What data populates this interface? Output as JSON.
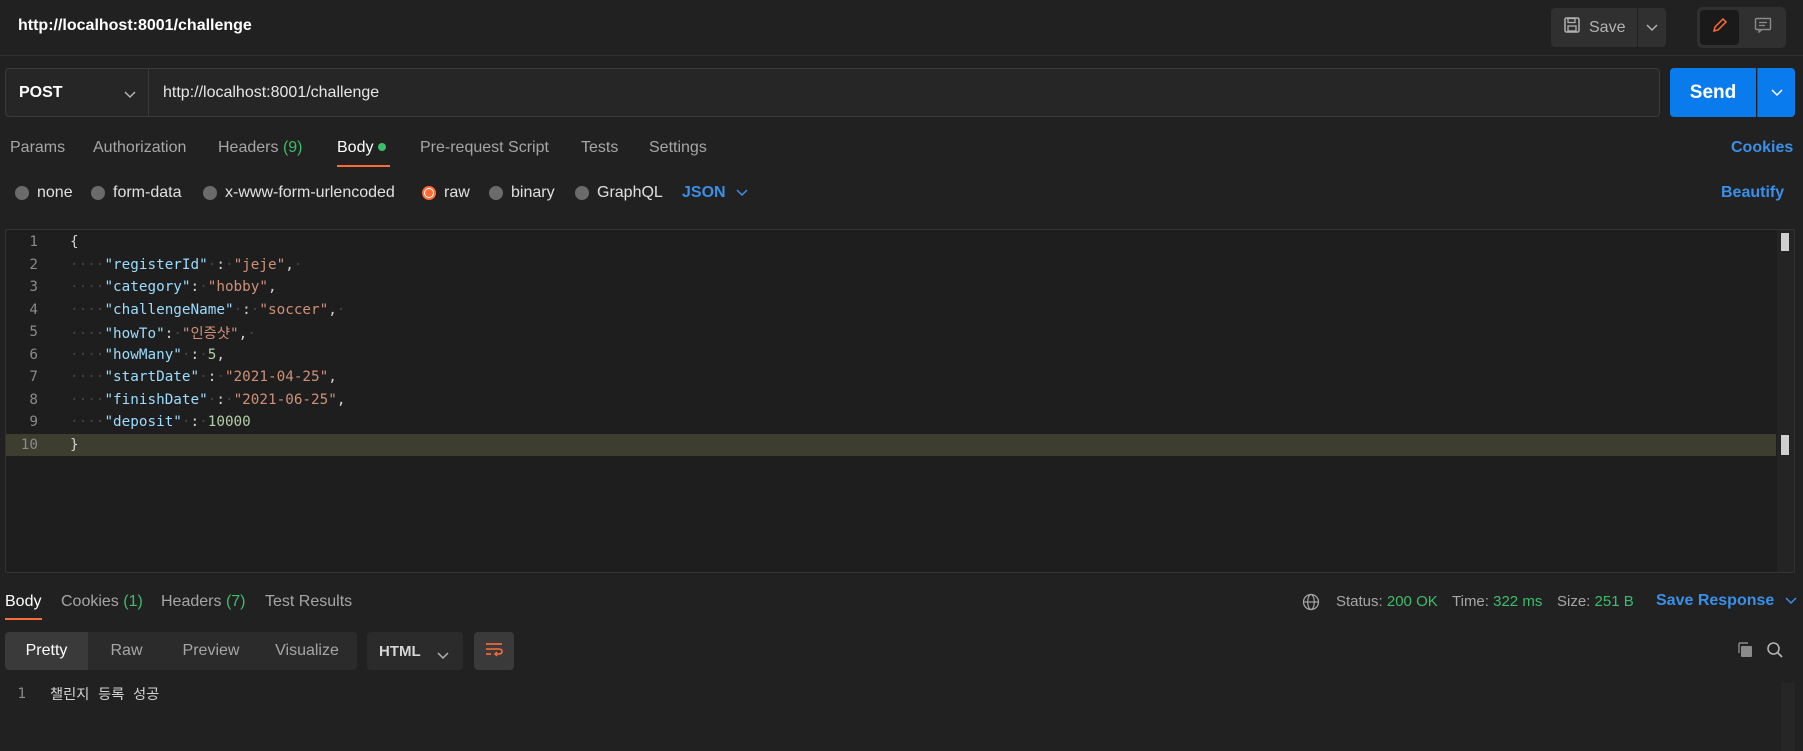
{
  "title": "http://localhost:8001/challenge",
  "header": {
    "save_label": "Save"
  },
  "request": {
    "method": "POST",
    "url": "http://localhost:8001/challenge",
    "send_label": "Send"
  },
  "tabs": {
    "params": "Params",
    "authorization": "Authorization",
    "headers": "Headers",
    "headers_count": "(9)",
    "body": "Body",
    "prerequest": "Pre-request Script",
    "tests": "Tests",
    "settings": "Settings",
    "cookies": "Cookies"
  },
  "body_types": {
    "none": "none",
    "form_data": "form-data",
    "urlencoded": "x-www-form-urlencoded",
    "raw": "raw",
    "binary": "binary",
    "graphql": "GraphQL",
    "selected": "raw",
    "format": "JSON",
    "beautify": "Beautify"
  },
  "editor": {
    "lines": [
      {
        "num": "1",
        "parts": [
          [
            "p",
            "{"
          ]
        ]
      },
      {
        "num": "2",
        "parts": [
          [
            "w",
            "····"
          ],
          [
            "k",
            "\"registerId\""
          ],
          [
            "w",
            "·"
          ],
          [
            "p",
            ":"
          ],
          [
            "w",
            "·"
          ],
          [
            "s",
            "\"jeje\""
          ],
          [
            "p",
            ","
          ],
          [
            "w",
            "·"
          ]
        ]
      },
      {
        "num": "3",
        "parts": [
          [
            "w",
            "····"
          ],
          [
            "k",
            "\"category\""
          ],
          [
            "p",
            ":"
          ],
          [
            "w",
            "·"
          ],
          [
            "s",
            "\"hobby\""
          ],
          [
            "p",
            ","
          ]
        ]
      },
      {
        "num": "4",
        "parts": [
          [
            "w",
            "····"
          ],
          [
            "k",
            "\"challengeName\""
          ],
          [
            "w",
            "·"
          ],
          [
            "p",
            ":"
          ],
          [
            "w",
            "·"
          ],
          [
            "s",
            "\"soccer\""
          ],
          [
            "p",
            ","
          ],
          [
            "w",
            "·"
          ]
        ]
      },
      {
        "num": "5",
        "parts": [
          [
            "w",
            "····"
          ],
          [
            "k",
            "\"howTo\""
          ],
          [
            "p",
            ":"
          ],
          [
            "w",
            "·"
          ],
          [
            "s",
            "\"인증샷\""
          ],
          [
            "p",
            ","
          ],
          [
            "w",
            "·"
          ]
        ]
      },
      {
        "num": "6",
        "parts": [
          [
            "w",
            "····"
          ],
          [
            "k",
            "\"howMany\""
          ],
          [
            "w",
            "·"
          ],
          [
            "p",
            ":"
          ],
          [
            "w",
            "·"
          ],
          [
            "n",
            "5"
          ],
          [
            "p",
            ","
          ]
        ]
      },
      {
        "num": "7",
        "parts": [
          [
            "w",
            "····"
          ],
          [
            "k",
            "\"startDate\""
          ],
          [
            "w",
            "·"
          ],
          [
            "p",
            ":"
          ],
          [
            "w",
            "·"
          ],
          [
            "s",
            "\"2021-04-25\""
          ],
          [
            "p",
            ","
          ]
        ]
      },
      {
        "num": "8",
        "parts": [
          [
            "w",
            "····"
          ],
          [
            "k",
            "\"finishDate\""
          ],
          [
            "w",
            "·"
          ],
          [
            "p",
            ":"
          ],
          [
            "w",
            "·"
          ],
          [
            "s",
            "\"2021-06-25\""
          ],
          [
            "p",
            ","
          ]
        ]
      },
      {
        "num": "9",
        "parts": [
          [
            "w",
            "····"
          ],
          [
            "k",
            "\"deposit\""
          ],
          [
            "w",
            "·"
          ],
          [
            "p",
            ":"
          ],
          [
            "w",
            "·"
          ],
          [
            "n",
            "10000"
          ]
        ]
      },
      {
        "num": "10",
        "parts": [
          [
            "p",
            "}"
          ]
        ]
      }
    ]
  },
  "response": {
    "tabs": {
      "body": "Body",
      "cookies": "Cookies",
      "cookies_count": "(1)",
      "headers": "Headers",
      "headers_count": "(7)",
      "test_results": "Test Results"
    },
    "status_label": "Status:",
    "status_value": "200 OK",
    "time_label": "Time:",
    "time_value": "322 ms",
    "size_label": "Size:",
    "size_value": "251 B",
    "save_response": "Save Response",
    "formats": {
      "pretty": "Pretty",
      "raw": "Raw",
      "preview": "Preview",
      "visualize": "Visualize"
    },
    "language": "HTML",
    "line_num": "1",
    "content": "챌린지 등록 성공"
  },
  "colors": {
    "accent": "#ff6c37",
    "send": "#097bed",
    "link": "#3b8fe8",
    "success": "#3cbd6b"
  }
}
